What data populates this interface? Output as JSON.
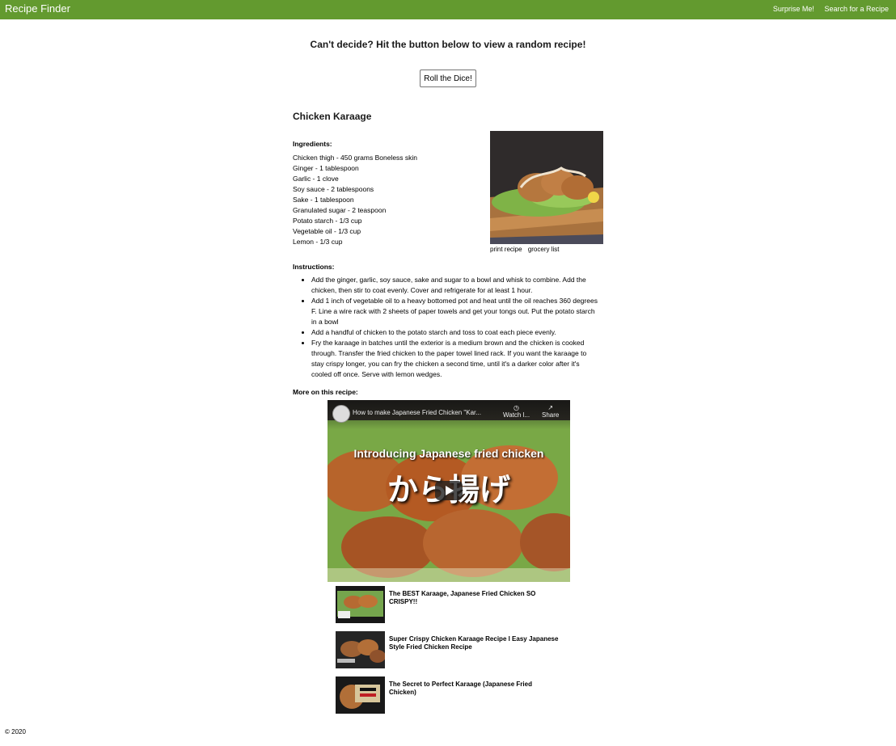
{
  "nav": {
    "brand": "Recipe Finder",
    "links": [
      "Surprise Me!",
      "Search for a Recipe"
    ]
  },
  "prompt": "Can't decide? Hit the button below to view a random recipe!",
  "roll_label": "Roll the Dice!",
  "recipe": {
    "title": "Chicken Karaage",
    "ingredients_label": "Ingredients:",
    "ingredients": [
      "Chicken thigh - 450 grams Boneless skin",
      "Ginger - 1 tablespoon",
      "Garlic - 1 clove",
      "Soy sauce - 2 tablespoons",
      "Sake - 1 tablespoon",
      "Granulated sugar - 2 teaspoon",
      "Potato starch - 1/3 cup",
      "Vegetable oil - 1/3 cup",
      "Lemon - 1/3 cup"
    ],
    "photo_links": [
      "print recipe",
      "grocery list"
    ],
    "instructions_label": "Instructions:",
    "instructions": [
      "Add the ginger, garlic, soy sauce, sake and sugar to a bowl and whisk to combine. Add the chicken, then stir to coat evenly. Cover and refrigerate for at least 1 hour.",
      "Add 1 inch of vegetable oil to a heavy bottomed pot and heat until the oil reaches 360 degrees F. Line a wire rack with 2 sheets of paper towels and get your tongs out. Put the potato starch in a bowl",
      "Add a handful of chicken to the potato starch and toss to coat each piece evenly.",
      "Fry the karaage in batches until the exterior is a medium brown and the chicken is cooked through. Transfer the fried chicken to the paper towel lined rack. If you want the karaage to stay crispy longer, you can fry the chicken a second time, until it's a darker color after it's cooled off once. Serve with lemon wedges."
    ],
    "more_label": "More on this recipe:"
  },
  "video": {
    "title": "How to make Japanese Fried Chicken \"Kar...",
    "watch_later": "Watch l...",
    "share": "Share",
    "overlay_en": "Introducing Japanese fried chicken",
    "overlay_jp": "から揚げ"
  },
  "related_videos": [
    "The BEST Karaage, Japanese Fried Chicken SO CRISPY!!",
    "Super Crispy Chicken Karaage Recipe l Easy Japanese Style Fried Chicken Recipe",
    "The Secret to Perfect Karaage (Japanese Fried Chicken)"
  ],
  "footer": "© 2020",
  "colors": {
    "nav": "#639a2f",
    "nav_text": "#ffffff"
  },
  "icons": {
    "watch_later": "clock-icon",
    "share": "share-arrow-icon",
    "play": "play-icon"
  }
}
